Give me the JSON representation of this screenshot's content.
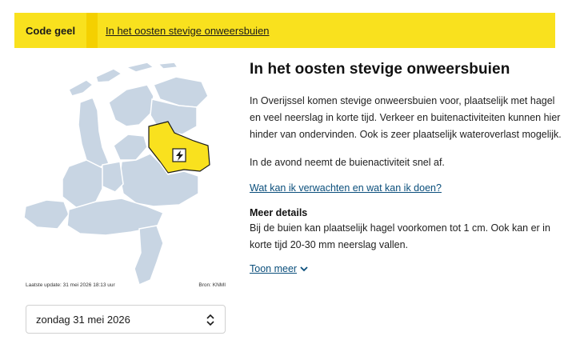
{
  "banner": {
    "code_label": "Code geel",
    "headline_link": "In het oosten stevige onweersbuien",
    "color": "#f9e11e"
  },
  "map": {
    "last_update": "Laatste update: 31 mei 2026 18:13 uur",
    "source": "Bron: KNMI",
    "province_color": "#c8d5e3",
    "warning_color": "#f9e11e",
    "warning_icon": "lightning-icon"
  },
  "date_select": {
    "value": "zondag 31 mei 2026"
  },
  "main": {
    "title": "In het oosten stevige onweersbuien",
    "paragraph1": "In Overijssel komen stevige onweersbuien voor, plaatselijk met hagel en veel neerslag in korte tijd. Verkeer en buitenactiviteiten kunnen hier hinder van ondervinden. Ook is zeer plaatselijk wateroverlast mogelijk.",
    "paragraph2": "In de avond neemt de buienactiviteit snel af.",
    "expect_link": "Wat kan ik verwachten en wat kan ik doen?",
    "details_heading": "Meer details",
    "details_text": "Bij de buien kan plaatselijk hagel voorkomen tot 1 cm. Ook kan er in korte tijd 20-30 mm neerslag vallen.",
    "more_link": "Toon meer"
  }
}
